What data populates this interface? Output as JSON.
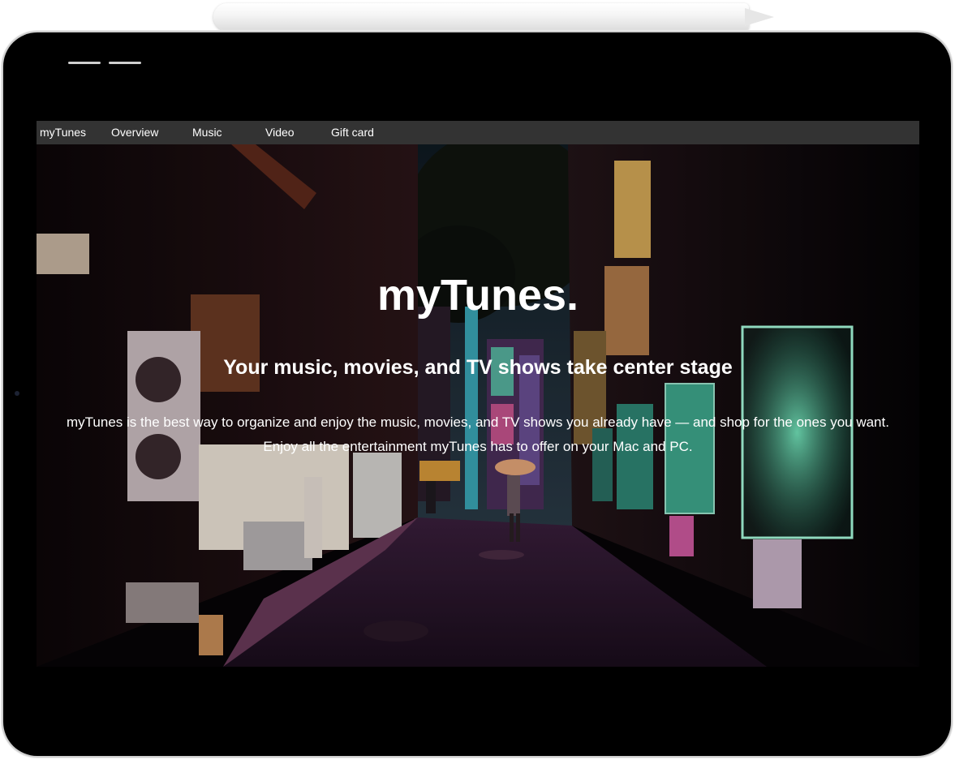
{
  "navbar": {
    "brand": "myTunes",
    "items": [
      "Overview",
      "Music",
      "Video",
      "Gift card"
    ]
  },
  "hero": {
    "title": "myTunes.",
    "subtitle": "Your music, movies, and TV shows take center stage",
    "body": "myTunes is the best way to organize and enjoy the music, movies, and TV shows you already have — and shop for the ones you want. Enjoy all the entertainment myTunes has to offer on your Mac and PC."
  },
  "colors": {
    "navbar_bg": "#333333",
    "nav_text": "#ffffff",
    "hero_text": "#ffffff",
    "device_frame": "#000000"
  },
  "icons": {
    "pencil": "apple-pencil-icon",
    "camera": "front-camera-icon"
  }
}
